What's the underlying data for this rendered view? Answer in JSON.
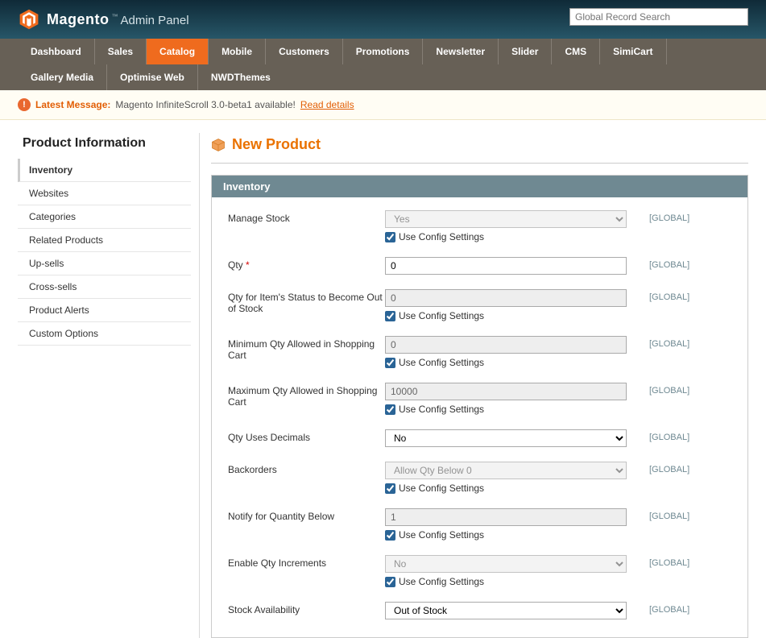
{
  "header": {
    "brand": "Magento",
    "panel": "Admin Panel",
    "search_placeholder": "Global Record Search"
  },
  "nav": {
    "items": [
      "Dashboard",
      "Sales",
      "Catalog",
      "Mobile",
      "Customers",
      "Promotions",
      "Newsletter",
      "Slider",
      "CMS",
      "SimiCart",
      "Gallery Media",
      "Optimise Web",
      "NWDThemes"
    ],
    "active": "Catalog"
  },
  "message": {
    "label": "Latest Message:",
    "text": "Magento InfiniteScroll 3.0-beta1 available!",
    "link": "Read details"
  },
  "sidebar": {
    "title": "Product Information",
    "items": [
      "Inventory",
      "Websites",
      "Categories",
      "Related Products",
      "Up-sells",
      "Cross-sells",
      "Product Alerts",
      "Custom Options"
    ],
    "active": "Inventory"
  },
  "page": {
    "title": "New Product"
  },
  "panel": {
    "head": "Inventory"
  },
  "form": {
    "use_config_label": "Use Config Settings",
    "scope_label": "[GLOBAL]",
    "rows": [
      {
        "key": "manage_stock",
        "label": "Manage Stock",
        "type": "select",
        "value": "Yes",
        "disabled": true,
        "checkbox": true
      },
      {
        "key": "qty",
        "label": "Qty",
        "required": true,
        "type": "text",
        "value": "0",
        "disabled": false,
        "checkbox": false
      },
      {
        "key": "qty_out",
        "label": "Qty for Item's Status to Become Out of Stock",
        "type": "text",
        "value": "0",
        "disabled": true,
        "checkbox": true
      },
      {
        "key": "min_qty",
        "label": "Minimum Qty Allowed in Shopping Cart",
        "type": "text",
        "value": "0",
        "disabled": true,
        "checkbox": true
      },
      {
        "key": "max_qty",
        "label": "Maximum Qty Allowed in Shopping Cart",
        "type": "text",
        "value": "10000",
        "disabled": true,
        "checkbox": true
      },
      {
        "key": "decimals",
        "label": "Qty Uses Decimals",
        "type": "select",
        "value": "No",
        "disabled": false,
        "checkbox": false
      },
      {
        "key": "backorders",
        "label": "Backorders",
        "type": "select",
        "value": "Allow Qty Below 0",
        "disabled": true,
        "checkbox": true
      },
      {
        "key": "notify",
        "label": "Notify for Quantity Below",
        "type": "text",
        "value": "1",
        "disabled": true,
        "checkbox": true
      },
      {
        "key": "increments",
        "label": "Enable Qty Increments",
        "type": "select",
        "value": "No",
        "disabled": true,
        "checkbox": true
      },
      {
        "key": "availability",
        "label": "Stock Availability",
        "type": "select",
        "value": "Out of Stock",
        "disabled": false,
        "checkbox": false
      }
    ]
  }
}
